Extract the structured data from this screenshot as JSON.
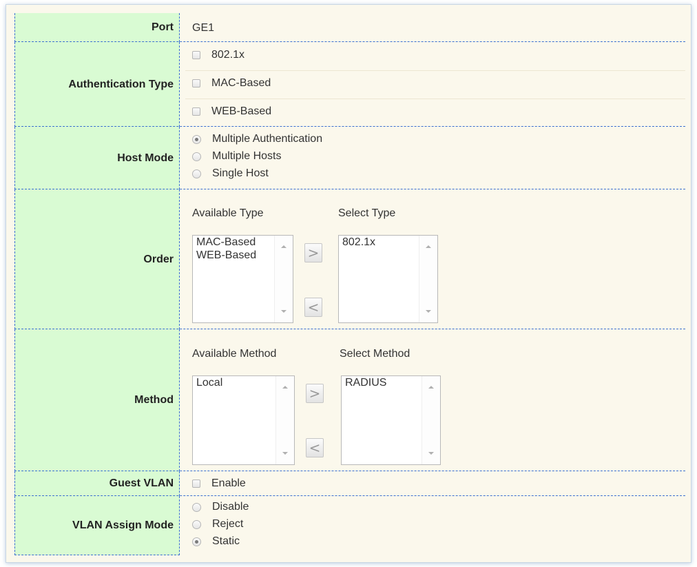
{
  "port": {
    "label": "Port",
    "value": "GE1"
  },
  "auth_type": {
    "label": "Authentication Type",
    "options": [
      {
        "label": "802.1x",
        "checked": false
      },
      {
        "label": "MAC-Based",
        "checked": false
      },
      {
        "label": "WEB-Based",
        "checked": false
      }
    ]
  },
  "host_mode": {
    "label": "Host Mode",
    "options": [
      {
        "label": "Multiple Authentication",
        "selected": true
      },
      {
        "label": "Multiple Hosts",
        "selected": false
      },
      {
        "label": "Single Host",
        "selected": false
      }
    ]
  },
  "order": {
    "label": "Order",
    "available_caption": "Available Type",
    "selected_caption": "Select Type",
    "available_items": [
      "MAC-Based",
      "WEB-Based"
    ],
    "selected_items": [
      "802.1x"
    ],
    "add_glyph": ">",
    "remove_glyph": "<"
  },
  "method": {
    "label": "Method",
    "available_caption": "Available Method",
    "selected_caption": "Select Method",
    "available_items": [
      "Local"
    ],
    "selected_items": [
      "RADIUS"
    ],
    "add_glyph": ">",
    "remove_glyph": "<"
  },
  "guest_vlan": {
    "label": "Guest VLAN",
    "option": "Enable",
    "checked": false
  },
  "vlan_assign_mode": {
    "label": "VLAN Assign Mode",
    "options": [
      {
        "label": "Disable",
        "selected": false
      },
      {
        "label": "Reject",
        "selected": false
      },
      {
        "label": "Static",
        "selected": true
      }
    ]
  },
  "colors": {
    "label_bg": "#d9fbd3",
    "value_bg": "#fbf8ec",
    "divider": "#3a6fd0"
  }
}
